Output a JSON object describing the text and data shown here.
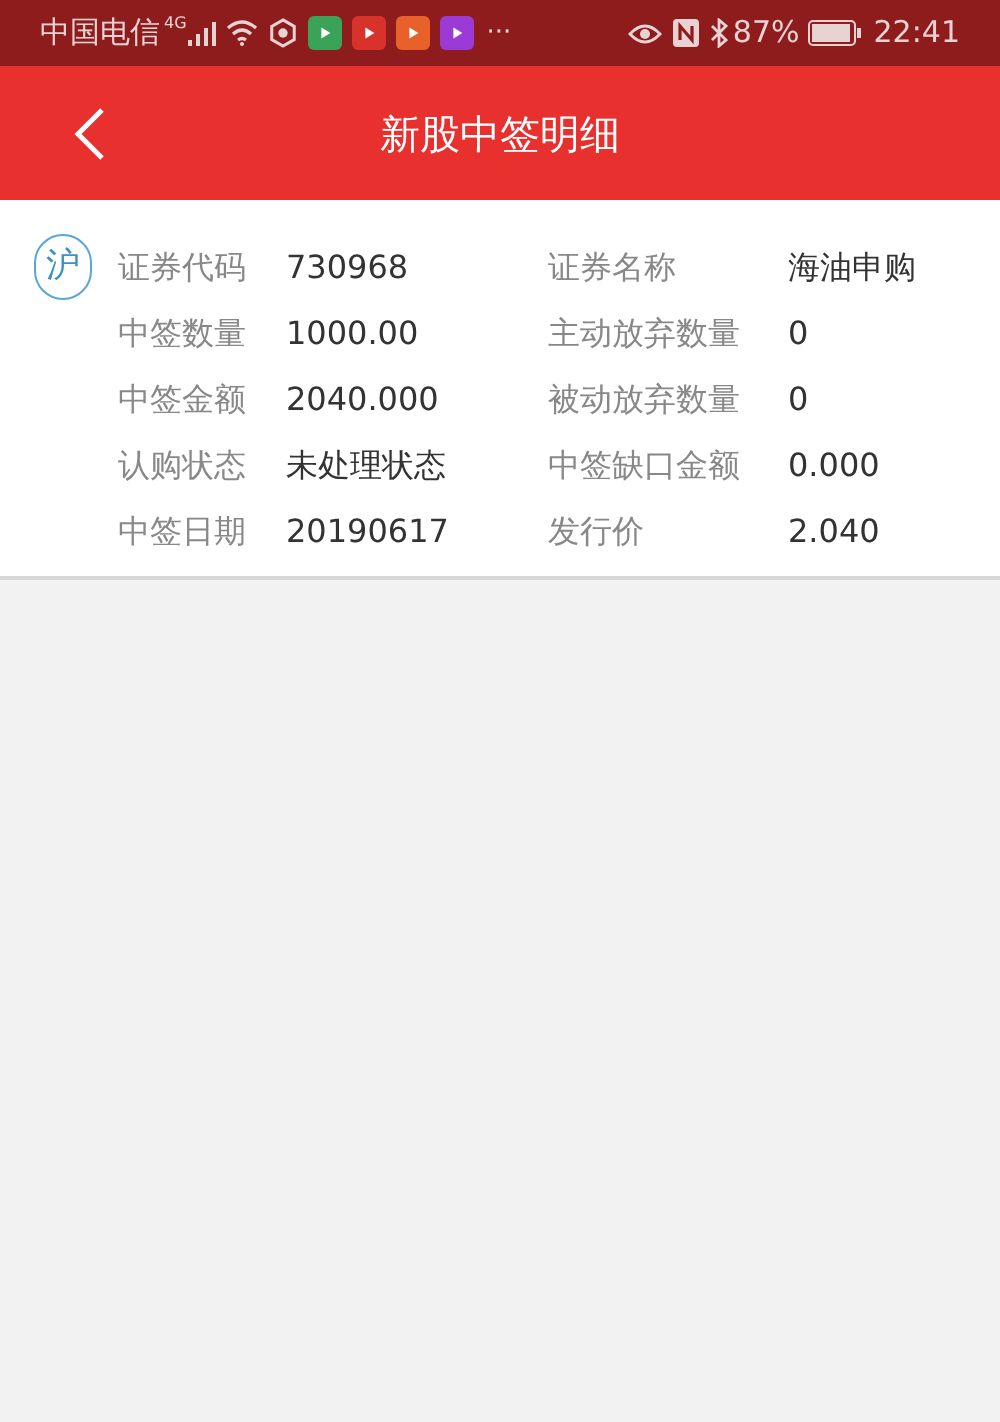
{
  "status_bar": {
    "carrier": "中国电信",
    "network": "4G",
    "more": "···",
    "battery": "87%",
    "time": "22:41"
  },
  "header": {
    "title": "新股中签明细"
  },
  "record": {
    "market": "沪",
    "fields": [
      {
        "label": "证券代码",
        "value": "730968"
      },
      {
        "label": "证券名称",
        "value": "海油申购"
      },
      {
        "label": "中签数量",
        "value": "1000.00"
      },
      {
        "label": "主动放弃数量",
        "value": "0"
      },
      {
        "label": "中签金额",
        "value": "2040.000"
      },
      {
        "label": "被动放弃数量",
        "value": "0"
      },
      {
        "label": "认购状态",
        "value": "未处理状态"
      },
      {
        "label": "中签缺口金额",
        "value": "0.000"
      },
      {
        "label": "中签日期",
        "value": "20190617"
      },
      {
        "label": "发行价",
        "value": "2.040"
      }
    ]
  }
}
